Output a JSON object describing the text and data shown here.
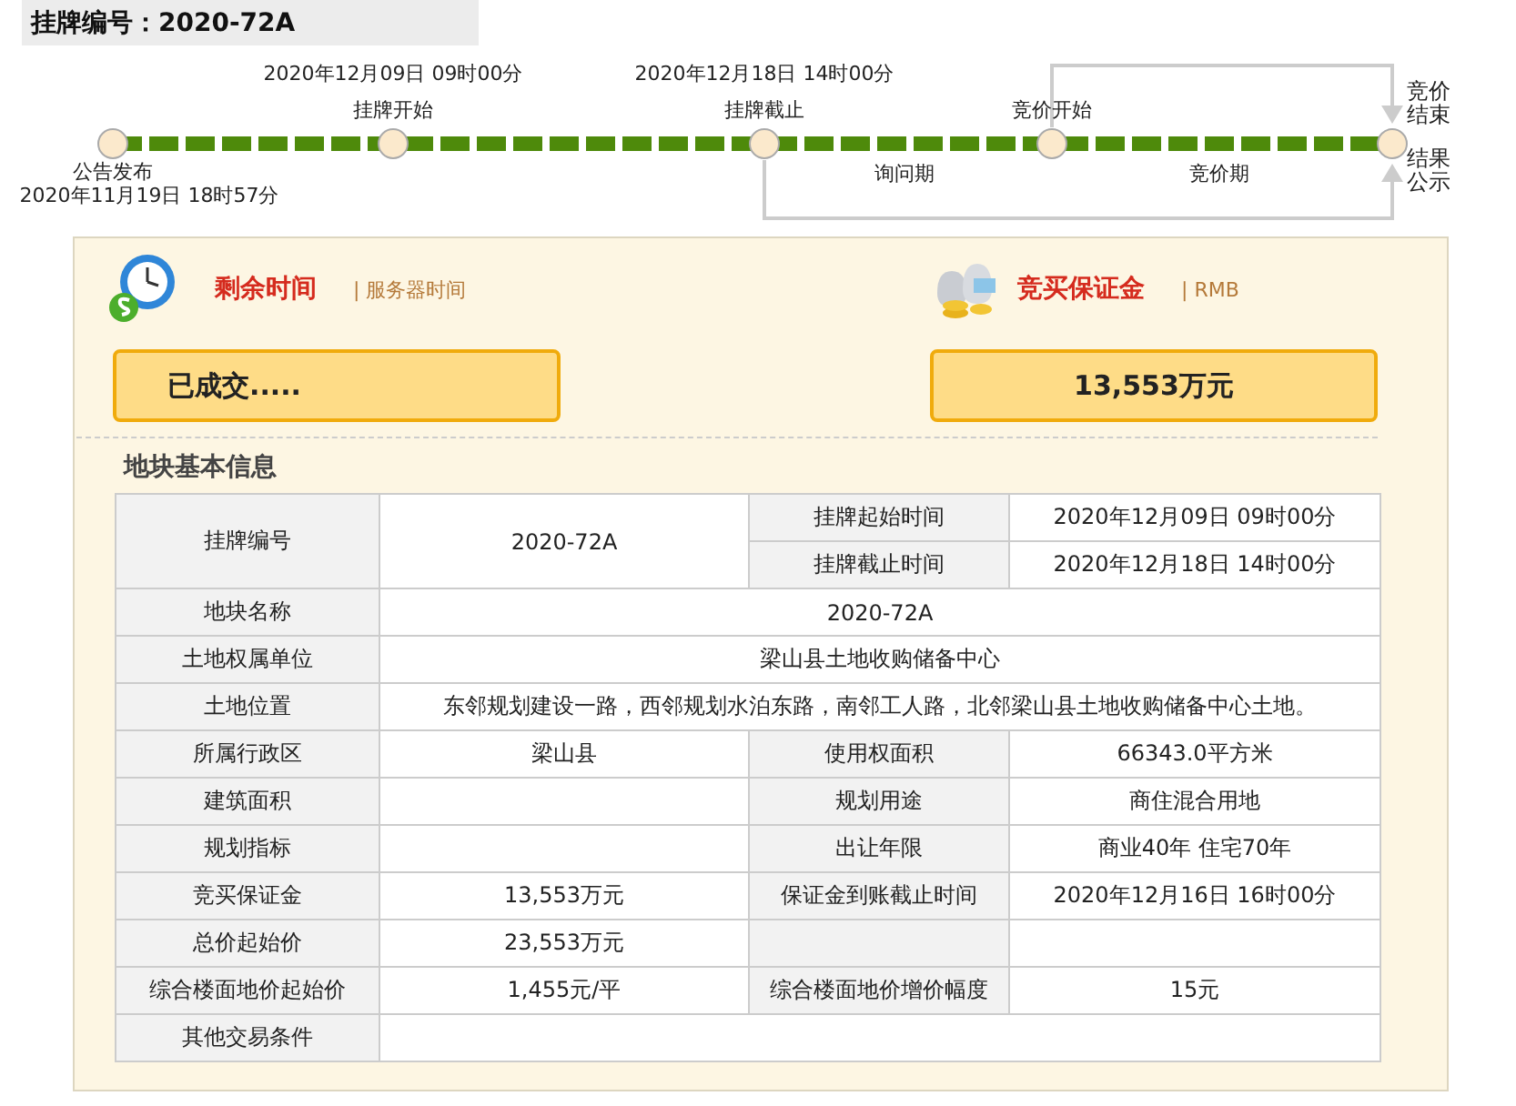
{
  "header": {
    "title": "挂牌编号：2020-72A"
  },
  "timeline": {
    "nodes": [
      {
        "label": "公告发布",
        "date": "2020年11月19日  18时57分"
      },
      {
        "label": "挂牌开始",
        "date": "2020年12月09日  09时00分"
      },
      {
        "label": "挂牌截止",
        "date": "2020年12月18日  14时00分"
      },
      {
        "label": "竞价开始"
      },
      {
        "label": "竞价结束"
      }
    ],
    "periods": [
      "询问期",
      "竞价期"
    ],
    "result": "结果公示"
  },
  "status": [
    {
      "kind": "time",
      "title": "剩余时间",
      "note": "| 服务器时间",
      "value": "已成交....."
    },
    {
      "kind": "deposit",
      "title": "竞买保证金",
      "note": "| RMB",
      "value": "13,553万元"
    }
  ],
  "section_title": "地块基本信息",
  "table": {
    "rows": [
      {
        "cells": [
          {
            "kind": "label",
            "text": "挂牌编号",
            "rowspan": 2
          },
          {
            "kind": "value",
            "text": "2020-72A",
            "rowspan": 2
          },
          {
            "kind": "label",
            "text": "挂牌起始时间"
          },
          {
            "kind": "value",
            "text": "2020年12月09日 09时00分"
          }
        ]
      },
      {
        "cells": [
          {
            "kind": "label",
            "text": "挂牌截止时间"
          },
          {
            "kind": "value",
            "text": "2020年12月18日 14时00分"
          }
        ]
      },
      {
        "cells": [
          {
            "kind": "label",
            "text": "地块名称"
          },
          {
            "kind": "value",
            "text": "2020-72A",
            "colspan": 3
          }
        ]
      },
      {
        "cells": [
          {
            "kind": "label",
            "text": "土地权属单位"
          },
          {
            "kind": "value",
            "text": "梁山县土地收购储备中心",
            "colspan": 3
          }
        ]
      },
      {
        "cells": [
          {
            "kind": "label",
            "text": "土地位置"
          },
          {
            "kind": "value",
            "text": "东邻规划建设一路，西邻规划水泊东路，南邻工人路，北邻梁山县土地收购储备中心土地。",
            "colspan": 3
          }
        ]
      },
      {
        "cells": [
          {
            "kind": "label",
            "text": "所属行政区"
          },
          {
            "kind": "value",
            "text": "梁山县"
          },
          {
            "kind": "label",
            "text": "使用权面积"
          },
          {
            "kind": "value",
            "text": "66343.0平方米"
          }
        ]
      },
      {
        "cells": [
          {
            "kind": "label",
            "text": "建筑面积"
          },
          {
            "kind": "value"
          },
          {
            "kind": "label",
            "text": "规划用途"
          },
          {
            "kind": "value",
            "text": "商住混合用地"
          }
        ]
      },
      {
        "cells": [
          {
            "kind": "label",
            "text": "规划指标"
          },
          {
            "kind": "value"
          },
          {
            "kind": "label",
            "text": "出让年限"
          },
          {
            "kind": "value",
            "text": "商业40年  住宅70年"
          }
        ]
      },
      {
        "cells": [
          {
            "kind": "label",
            "text": "竞买保证金"
          },
          {
            "kind": "value",
            "text": "13,553万元"
          },
          {
            "kind": "label",
            "text": "保证金到账截止时间"
          },
          {
            "kind": "value",
            "text": "2020年12月16日  16时00分"
          }
        ]
      },
      {
        "cells": [
          {
            "kind": "label",
            "text": "总价起始价"
          },
          {
            "kind": "value",
            "text": "23,553万元"
          },
          {
            "kind": "label"
          },
          {
            "kind": "value"
          }
        ]
      },
      {
        "cells": [
          {
            "kind": "label",
            "text": "综合楼面地价起始价"
          },
          {
            "kind": "value",
            "text": "1,455元/平"
          },
          {
            "kind": "label",
            "text": "综合楼面地价增价幅度"
          },
          {
            "kind": "value",
            "text": "15元"
          }
        ]
      },
      {
        "cells": [
          {
            "kind": "label",
            "text": "其他交易条件"
          },
          {
            "kind": "value",
            "colspan": 3
          }
        ]
      }
    ]
  }
}
